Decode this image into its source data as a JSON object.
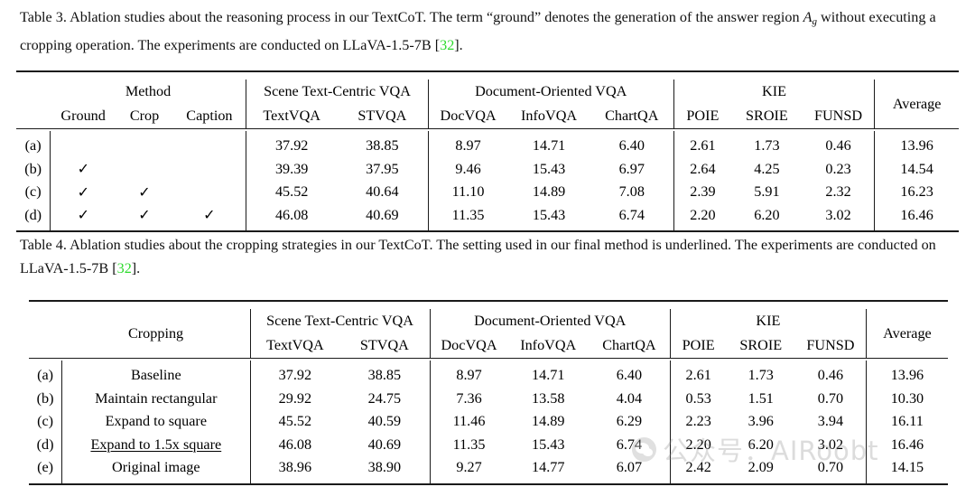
{
  "document": {
    "type": "academic-paper-tables",
    "citation_color": "#2ddb2d"
  },
  "table3": {
    "caption": {
      "label": "Table 3.",
      "text_part1": "Ablation studies about the reasoning process in our TextCoT. The term “ground” denotes the generation of the answer region ",
      "symbol": "A",
      "symbol_sub": "g",
      "text_part2": " without executing a cropping operation. The experiments are conducted on LLaVA-1.5-7B [",
      "citation": "32",
      "text_part3": "]."
    },
    "group_headers": {
      "method": "Method",
      "scene": "Scene Text-Centric VQA",
      "document": "Document-Oriented VQA",
      "kie": "KIE",
      "average": "Average"
    },
    "sub_headers": {
      "ground": "Ground",
      "crop": "Crop",
      "caption": "Caption",
      "textvqa": "TextVQA",
      "stvqa": "STVQA",
      "docvqa": "DocVQA",
      "infovqa": "InfoVQA",
      "chartqa": "ChartQA",
      "poie": "POIE",
      "sroie": "SROIE",
      "funsd": "FUNSD"
    },
    "check_glyph": "✓",
    "rows": [
      {
        "index": "(a)",
        "ground": "",
        "crop": "",
        "caption": "",
        "values": [
          {
            "v": "37.92",
            "bold": false
          },
          {
            "v": "38.85",
            "bold": false
          },
          {
            "v": "8.97",
            "bold": false
          },
          {
            "v": "14.71",
            "bold": false
          },
          {
            "v": "6.40",
            "bold": false
          },
          {
            "v": "2.61",
            "bold": false
          },
          {
            "v": "1.73",
            "bold": false
          },
          {
            "v": "0.46",
            "bold": false
          },
          {
            "v": "13.96",
            "bold": false
          }
        ]
      },
      {
        "index": "(b)",
        "ground": "✓",
        "crop": "",
        "caption": "",
        "values": [
          {
            "v": "39.39",
            "bold": false
          },
          {
            "v": "37.95",
            "bold": false
          },
          {
            "v": "9.46",
            "bold": false
          },
          {
            "v": "15.43",
            "bold": true
          },
          {
            "v": "6.97",
            "bold": false
          },
          {
            "v": "2.64",
            "bold": true
          },
          {
            "v": "4.25",
            "bold": false
          },
          {
            "v": "0.23",
            "bold": false
          },
          {
            "v": "14.54",
            "bold": false
          }
        ]
      },
      {
        "index": "(c)",
        "ground": "✓",
        "crop": "✓",
        "caption": "",
        "values": [
          {
            "v": "45.52",
            "bold": false
          },
          {
            "v": "40.64",
            "bold": false
          },
          {
            "v": "11.10",
            "bold": false
          },
          {
            "v": "14.89",
            "bold": false
          },
          {
            "v": "7.08",
            "bold": true
          },
          {
            "v": "2.39",
            "bold": false
          },
          {
            "v": "5.91",
            "bold": false
          },
          {
            "v": "2.32",
            "bold": false
          },
          {
            "v": "16.23",
            "bold": false
          }
        ]
      },
      {
        "index": "(d)",
        "ground": "✓",
        "crop": "✓",
        "caption": "✓",
        "values": [
          {
            "v": "46.08",
            "bold": true
          },
          {
            "v": "40.69",
            "bold": true
          },
          {
            "v": "11.35",
            "bold": true
          },
          {
            "v": "15.43",
            "bold": true
          },
          {
            "v": "6.74",
            "bold": false
          },
          {
            "v": "2.20",
            "bold": false
          },
          {
            "v": "6.20",
            "bold": true
          },
          {
            "v": "3.02",
            "bold": true
          },
          {
            "v": "16.46",
            "bold": true
          }
        ]
      }
    ]
  },
  "table4": {
    "caption": {
      "label": "Table 4.",
      "text_part1": "Ablation studies about the cropping strategies in our TextCoT. The setting used in our final method is underlined. The experiments are conducted on LLaVA-1.5-7B [",
      "citation": "32",
      "text_part2": "]."
    },
    "group_headers": {
      "cropping": "Cropping",
      "scene": "Scene Text-Centric VQA",
      "document": "Document-Oriented VQA",
      "kie": "KIE",
      "average": "Average"
    },
    "sub_headers": {
      "textvqa": "TextVQA",
      "stvqa": "STVQA",
      "docvqa": "DocVQA",
      "infovqa": "InfoVQA",
      "chartqa": "ChartQA",
      "poie": "POIE",
      "sroie": "SROIE",
      "funsd": "FUNSD"
    },
    "rows": [
      {
        "index": "(a)",
        "strategy": "Baseline",
        "underlined": false,
        "values": [
          {
            "v": "37.92",
            "bold": false
          },
          {
            "v": "38.85",
            "bold": false
          },
          {
            "v": "8.97",
            "bold": false
          },
          {
            "v": "14.71",
            "bold": false
          },
          {
            "v": "6.40",
            "bold": false
          },
          {
            "v": "2.61",
            "bold": true
          },
          {
            "v": "1.73",
            "bold": false
          },
          {
            "v": "0.46",
            "bold": false
          },
          {
            "v": "13.96",
            "bold": false
          }
        ]
      },
      {
        "index": "(b)",
        "strategy": "Maintain rectangular",
        "underlined": false,
        "values": [
          {
            "v": "29.92",
            "bold": false
          },
          {
            "v": "24.75",
            "bold": false
          },
          {
            "v": "7.36",
            "bold": false
          },
          {
            "v": "13.58",
            "bold": false
          },
          {
            "v": "4.04",
            "bold": false
          },
          {
            "v": "0.53",
            "bold": false
          },
          {
            "v": "1.51",
            "bold": false
          },
          {
            "v": "0.70",
            "bold": false
          },
          {
            "v": "10.30",
            "bold": false
          }
        ]
      },
      {
        "index": "(c)",
        "strategy": "Expand to square",
        "underlined": false,
        "values": [
          {
            "v": "45.52",
            "bold": false
          },
          {
            "v": "40.59",
            "bold": false
          },
          {
            "v": "11.46",
            "bold": true
          },
          {
            "v": "14.89",
            "bold": false
          },
          {
            "v": "6.29",
            "bold": false
          },
          {
            "v": "2.23",
            "bold": false
          },
          {
            "v": "3.96",
            "bold": false
          },
          {
            "v": "3.94",
            "bold": true
          },
          {
            "v": "16.11",
            "bold": false
          }
        ]
      },
      {
        "index": "(d)",
        "strategy": "Expand to 1.5x square",
        "underlined": true,
        "values": [
          {
            "v": "46.08",
            "bold": true
          },
          {
            "v": "40.69",
            "bold": true
          },
          {
            "v": "11.35",
            "bold": false
          },
          {
            "v": "15.43",
            "bold": true
          },
          {
            "v": "6.74",
            "bold": true
          },
          {
            "v": "2.20",
            "bold": false
          },
          {
            "v": "6.20",
            "bold": true
          },
          {
            "v": "3.02",
            "bold": false
          },
          {
            "v": "16.46",
            "bold": true
          }
        ]
      },
      {
        "index": "(e)",
        "strategy": "Original image",
        "underlined": false,
        "values": [
          {
            "v": "38.96",
            "bold": false
          },
          {
            "v": "38.90",
            "bold": false
          },
          {
            "v": "9.27",
            "bold": false
          },
          {
            "v": "14.77",
            "bold": false
          },
          {
            "v": "6.07",
            "bold": false
          },
          {
            "v": "2.42",
            "bold": false
          },
          {
            "v": "2.09",
            "bold": false
          },
          {
            "v": "0.70",
            "bold": false
          },
          {
            "v": "14.15",
            "bold": false
          }
        ]
      }
    ]
  },
  "watermark": {
    "text": "公众号：AIRoobt",
    "icon": "wechat-logo-icon"
  }
}
